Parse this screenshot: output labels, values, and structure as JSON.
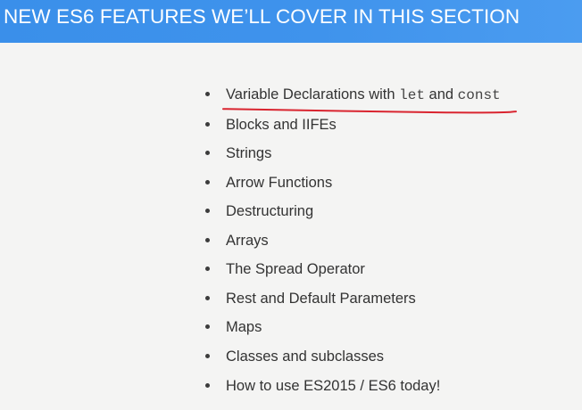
{
  "header": {
    "title": "NEW ES6 FEATURES WE’LL COVER IN THIS SECTION",
    "background_color": "#3f93ec",
    "text_color": "#ffffff"
  },
  "list": {
    "first_item": {
      "prefix": "Variable Declarations with ",
      "code_let": "let",
      "joiner": " and ",
      "code_const": "const"
    },
    "items": [
      "Blocks and IIFEs",
      "Strings",
      "Arrow Functions",
      "Destructuring",
      "Arrays",
      "The Spread Operator",
      "Rest and Default Parameters",
      "Maps",
      "Classes and subclasses",
      "How to use ES2015 / ES6 today!"
    ]
  },
  "annotation": {
    "underline_color": "#d9242f"
  }
}
